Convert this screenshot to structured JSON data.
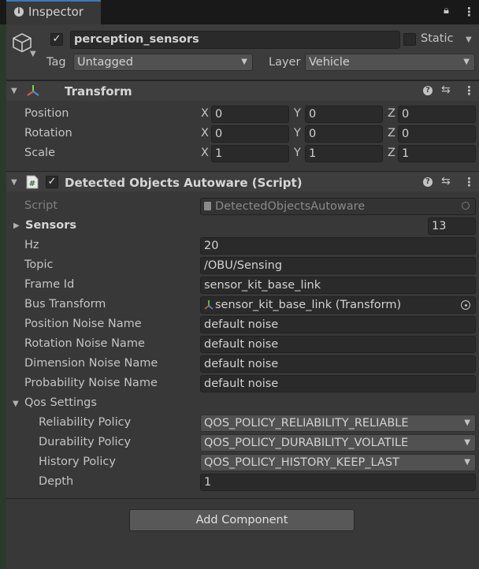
{
  "tab": {
    "title": "Inspector"
  },
  "object": {
    "name": "perception_sensors",
    "active": true,
    "static_label": "Static",
    "tag_label": "Tag",
    "tag_value": "Untagged",
    "layer_label": "Layer",
    "layer_value": "Vehicle"
  },
  "transform": {
    "title": "Transform",
    "rows": [
      {
        "label": "Position",
        "x": "0",
        "y": "0",
        "z": "0"
      },
      {
        "label": "Rotation",
        "x": "0",
        "y": "0",
        "z": "0"
      },
      {
        "label": "Scale",
        "x": "1",
        "y": "1",
        "z": "1"
      }
    ],
    "axis": {
      "x": "X",
      "y": "Y",
      "z": "Z"
    }
  },
  "script": {
    "title": "Detected Objects Autoware (Script)",
    "enabled": true,
    "script_label": "Script",
    "script_value": "DetectedObjectsAutoware",
    "sensors_label": "Sensors",
    "sensors_count": "13",
    "fields": [
      {
        "label": "Hz",
        "value": "20"
      },
      {
        "label": "Topic",
        "value": "/OBU/Sensing"
      },
      {
        "label": "Frame Id",
        "value": "sensor_kit_base_link"
      },
      {
        "label": "Bus Transform",
        "value": "sensor_kit_base_link (Transform)"
      },
      {
        "label": "Position Noise Name",
        "value": "default noise"
      },
      {
        "label": "Rotation Noise Name",
        "value": "default noise"
      },
      {
        "label": "Dimension Noise Name",
        "value": "default noise"
      },
      {
        "label": "Probability Noise Name",
        "value": "default noise"
      }
    ],
    "qos": {
      "label": "Qos Settings",
      "reliability_label": "Reliability Policy",
      "reliability_value": "QOS_POLICY_RELIABILITY_RELIABLE",
      "durability_label": "Durability Policy",
      "durability_value": "QOS_POLICY_DURABILITY_VOLATILE",
      "history_label": "History Policy",
      "history_value": "QOS_POLICY_HISTORY_KEEP_LAST",
      "depth_label": "Depth",
      "depth_value": "1"
    }
  },
  "add_component": "Add Component",
  "colors": {
    "accent": "#3a79bb",
    "background": "#383838",
    "field": "#2a2a2a"
  }
}
